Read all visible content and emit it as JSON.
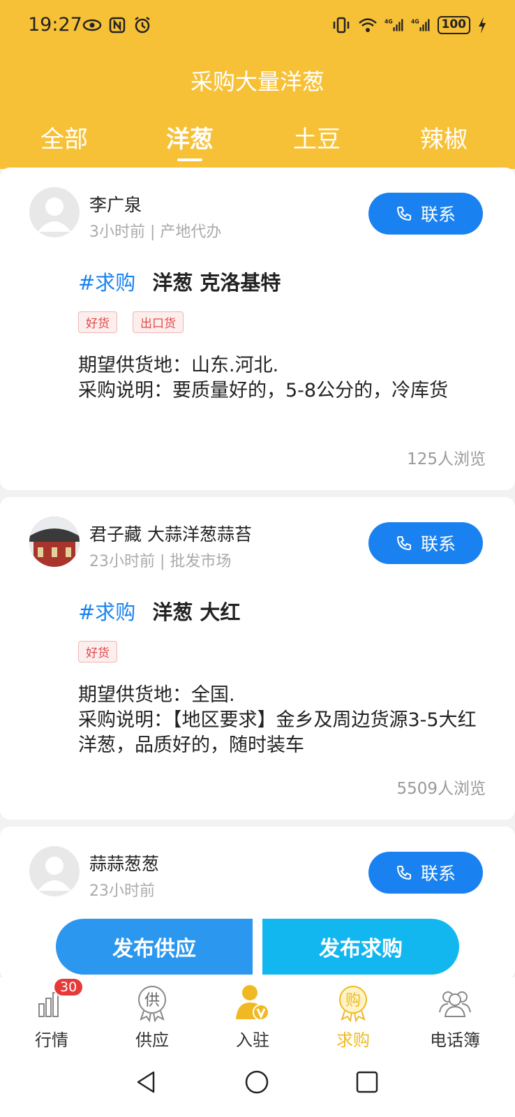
{
  "status_bar": {
    "time": "19:27",
    "battery": "100"
  },
  "page_title": "采购大量洋葱",
  "tabs": [
    {
      "label": "全部"
    },
    {
      "label": "洋葱"
    },
    {
      "label": "土豆"
    },
    {
      "label": "辣椒"
    }
  ],
  "active_tab": "洋葱",
  "posts": [
    {
      "name": "李广泉",
      "meta": "3小时前 | 产地代办",
      "contact_label": "联系",
      "hashtag": "#求购",
      "product": "洋葱 克洛基特",
      "labels": [
        "好货",
        "出口货"
      ],
      "desc_line1": "期望供货地：山东.河北.",
      "desc_line2": "采购说明：要质量好的，5-8公分的，冷库货",
      "views": "125人浏览"
    },
    {
      "name": "君子藏 大蒜洋葱蒜苔",
      "meta": "23小时前 | 批发市场",
      "contact_label": "联系",
      "hashtag": "#求购",
      "product": "洋葱 大红",
      "labels": [
        "好货"
      ],
      "desc_line1": "期望供货地：全国.",
      "desc_line2": "采购说明：【地区要求】金乡及周边货源3-5大红洋葱，品质好的，随时装车",
      "views": "5509人浏览"
    },
    {
      "name": "蒜蒜葱葱",
      "meta": "23小时前",
      "contact_label": "联系"
    }
  ],
  "actions": {
    "publish_supply": "发布供应",
    "publish_purchase": "发布求购"
  },
  "bottom_nav": [
    {
      "label": "行情",
      "icon": "bar-chart-icon",
      "badge": "30"
    },
    {
      "label": "供应",
      "icon": "supply-seal-icon"
    },
    {
      "label": "入驻",
      "icon": "user-v-icon"
    },
    {
      "label": "求购",
      "icon": "purchase-seal-icon",
      "active": true
    },
    {
      "label": "电话簿",
      "icon": "contacts-icon"
    }
  ],
  "colors": {
    "header": "#f7c137",
    "accent_blue": "#1a82f0",
    "active_nav": "#f0b823",
    "tag_red": "#e04848"
  }
}
